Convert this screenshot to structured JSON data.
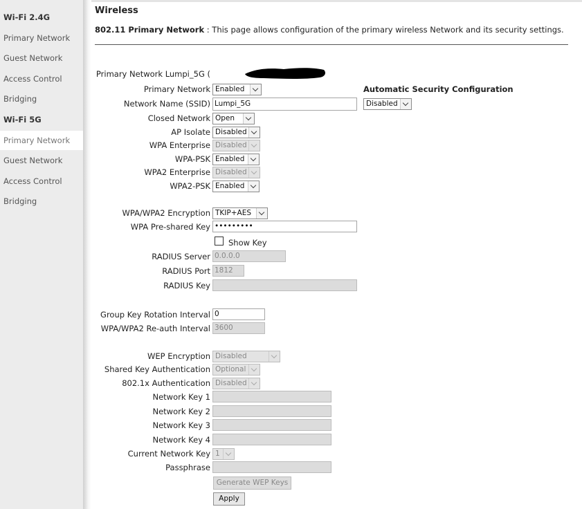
{
  "sidebar": {
    "sections": [
      {
        "title": "Wi-Fi 2.4G",
        "items": [
          "Primary Network",
          "Guest Network",
          "Access Control",
          "Bridging"
        ]
      },
      {
        "title": "Wi-Fi 5G",
        "items": [
          "Primary Network",
          "Guest Network",
          "Access Control",
          "Bridging"
        ]
      }
    ],
    "active_item": "Wi-Fi 5G / Primary Network"
  },
  "page": {
    "title": "Wireless",
    "desc_bold": "802.11 Primary Network",
    "desc_text": " :  This page allows configuration of the primary wireless Network and its security settings."
  },
  "form": {
    "primary_network_name_label": "Primary Network Lumpi_5G (",
    "primary_network": {
      "label": "Primary Network",
      "value": "Enabled"
    },
    "auto_security": {
      "heading": "Automatic Security Configuration",
      "value": "Disabled"
    },
    "ssid": {
      "label": "Network Name (SSID)",
      "value": "Lumpi_5G"
    },
    "closed_network": {
      "label": "Closed Network",
      "value": "Open"
    },
    "ap_isolate": {
      "label": "AP Isolate",
      "value": "Disabled"
    },
    "wpa_enterprise": {
      "label": "WPA Enterprise",
      "value": "Disabled"
    },
    "wpa_psk": {
      "label": "WPA-PSK",
      "value": "Enabled"
    },
    "wpa2_enterprise": {
      "label": "WPA2 Enterprise",
      "value": "Disabled"
    },
    "wpa2_psk": {
      "label": "WPA2-PSK",
      "value": "Enabled"
    },
    "encryption": {
      "label": "WPA/WPA2 Encryption",
      "value": "TKIP+AES"
    },
    "psk": {
      "label": "WPA Pre-shared Key",
      "value": "•••••••••"
    },
    "show_key": {
      "label": "Show Key"
    },
    "radius_server": {
      "label": "RADIUS Server",
      "value": "0.0.0.0"
    },
    "radius_port": {
      "label": "RADIUS Port",
      "value": "1812"
    },
    "radius_key": {
      "label": "RADIUS Key",
      "value": ""
    },
    "group_key": {
      "label": "Group Key Rotation Interval",
      "value": "0"
    },
    "reauth": {
      "label": "WPA/WPA2 Re-auth Interval",
      "value": "3600"
    },
    "wep_encryption": {
      "label": "WEP Encryption",
      "value": "Disabled"
    },
    "shared_key_auth": {
      "label": "Shared Key Authentication",
      "value": "Optional"
    },
    "auth_8021x": {
      "label": "802.1x Authentication",
      "value": "Disabled"
    },
    "network_key_1": {
      "label": "Network Key 1",
      "value": ""
    },
    "network_key_2": {
      "label": "Network Key 2",
      "value": ""
    },
    "network_key_3": {
      "label": "Network Key 3",
      "value": ""
    },
    "network_key_4": {
      "label": "Network Key 4",
      "value": ""
    },
    "current_network_key": {
      "label": "Current Network Key",
      "value": "1"
    },
    "passphrase": {
      "label": "Passphrase",
      "value": ""
    },
    "generate_wep": {
      "label": "Generate WEP Keys"
    },
    "apply": {
      "label": "Apply"
    }
  }
}
